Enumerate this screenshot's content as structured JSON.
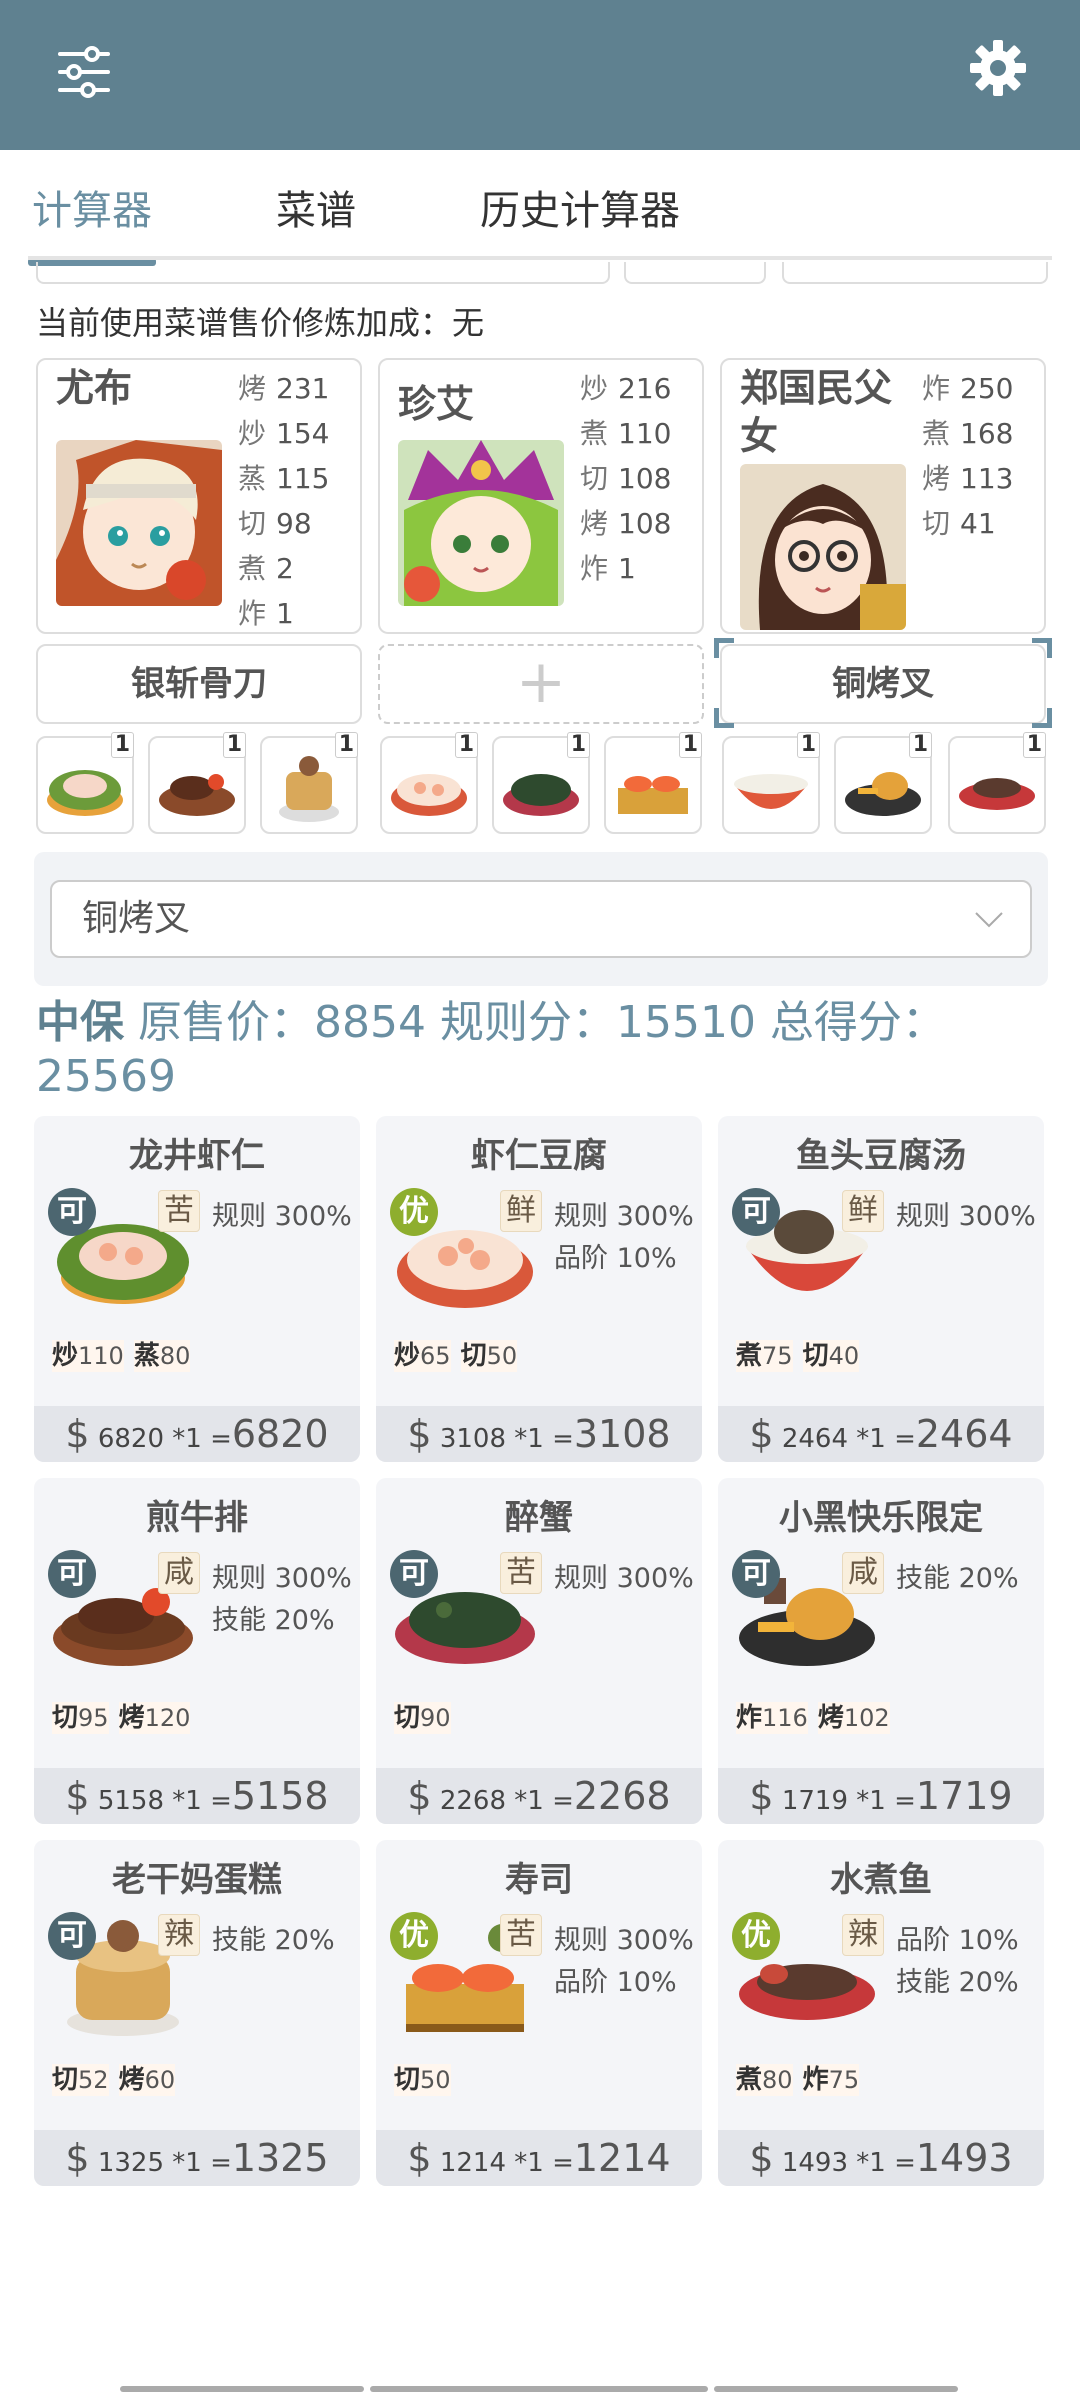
{
  "tabs": [
    {
      "label": "计算器"
    },
    {
      "label": "菜谱"
    },
    {
      "label": "历史计算器"
    }
  ],
  "bonus_text": "当前使用菜谱售价修炼加成：无",
  "chefs": [
    {
      "name": "尤布",
      "stats": [
        {
          "k": "烤",
          "v": "231"
        },
        {
          "k": "炒",
          "v": "154"
        },
        {
          "k": "蒸",
          "v": "115"
        },
        {
          "k": "切",
          "v": "98"
        },
        {
          "k": "煮",
          "v": "2"
        },
        {
          "k": "炸",
          "v": "1"
        }
      ]
    },
    {
      "name": "珍艾",
      "stats": [
        {
          "k": "炒",
          "v": "216"
        },
        {
          "k": "煮",
          "v": "110"
        },
        {
          "k": "切",
          "v": "108"
        },
        {
          "k": "烤",
          "v": "108"
        },
        {
          "k": "炸",
          "v": "1"
        }
      ]
    },
    {
      "name": "郑国民父女",
      "stats": [
        {
          "k": "炸",
          "v": "250"
        },
        {
          "k": "煮",
          "v": "168"
        },
        {
          "k": "烤",
          "v": "113"
        },
        {
          "k": "切",
          "v": "41"
        }
      ]
    }
  ],
  "tools": {
    "t1": "银斩骨刀",
    "t2_plus": "+",
    "t3": "铜烤叉"
  },
  "mini_qty": "1",
  "select_value": "铜烤叉",
  "summary": {
    "tier": "中保",
    "text": "原售价：8854 规则分：15510 总得分：25569"
  },
  "dishes": [
    {
      "name": "龙井虾仁",
      "badge": "可",
      "flavor": "苦",
      "rules": [
        "规则 300%"
      ],
      "reqs": [
        {
          "k": "炒",
          "v": "110"
        },
        {
          "k": "蒸",
          "v": "80"
        }
      ],
      "unit": "6820 *1 =",
      "total": "6820"
    },
    {
      "name": "虾仁豆腐",
      "badge": "优",
      "flavor": "鲜",
      "rules": [
        "规则 300%",
        "品阶 10%"
      ],
      "reqs": [
        {
          "k": "炒",
          "v": "65"
        },
        {
          "k": "切",
          "v": "50"
        }
      ],
      "unit": "3108 *1 =",
      "total": "3108"
    },
    {
      "name": "鱼头豆腐汤",
      "badge": "可",
      "flavor": "鲜",
      "rules": [
        "规则 300%"
      ],
      "reqs": [
        {
          "k": "煮",
          "v": "75"
        },
        {
          "k": "切",
          "v": "40"
        }
      ],
      "unit": "2464 *1 =",
      "total": "2464"
    },
    {
      "name": "煎牛排",
      "badge": "可",
      "flavor": "咸",
      "rules": [
        "规则 300%",
        "技能 20%"
      ],
      "reqs": [
        {
          "k": "切",
          "v": "95"
        },
        {
          "k": "烤",
          "v": "120"
        }
      ],
      "unit": "5158 *1 =",
      "total": "5158"
    },
    {
      "name": "醉蟹",
      "badge": "可",
      "flavor": "苦",
      "rules": [
        "规则 300%"
      ],
      "reqs": [
        {
          "k": "切",
          "v": "90"
        }
      ],
      "unit": "2268 *1 =",
      "total": "2268"
    },
    {
      "name": "小黑快乐限定",
      "badge": "可",
      "flavor": "咸",
      "rules": [
        "技能 20%"
      ],
      "reqs": [
        {
          "k": "炸",
          "v": "116"
        },
        {
          "k": "烤",
          "v": "102"
        }
      ],
      "unit": "1719 *1 =",
      "total": "1719"
    },
    {
      "name": "老干妈蛋糕",
      "badge": "可",
      "flavor": "辣",
      "rules": [
        "技能 20%"
      ],
      "reqs": [
        {
          "k": "切",
          "v": "52"
        },
        {
          "k": "烤",
          "v": "60"
        }
      ],
      "unit": "1325 *1 =",
      "total": "1325"
    },
    {
      "name": "寿司",
      "badge": "优",
      "flavor": "苦",
      "rules": [
        "规则 300%",
        "品阶 10%"
      ],
      "reqs": [
        {
          "k": "切",
          "v": "50"
        }
      ],
      "unit": "1214 *1 =",
      "total": "1214"
    },
    {
      "name": "水煮鱼",
      "badge": "优",
      "flavor": "辣",
      "rules": [
        "品阶 10%",
        "技能 20%"
      ],
      "reqs": [
        {
          "k": "煮",
          "v": "80"
        },
        {
          "k": "炸",
          "v": "75"
        }
      ],
      "unit": "1493 *1 =",
      "total": "1493"
    }
  ],
  "colors": {
    "header": "#5f8190",
    "accent": "#6a8fa2",
    "badge_ke": "#4c6670",
    "badge_you": "#8eae2e",
    "card_bg": "#f4f5f8"
  },
  "icons": {
    "menu": "sliders-icon",
    "settings": "gear-icon",
    "dropdown": "chevron-down-icon"
  }
}
